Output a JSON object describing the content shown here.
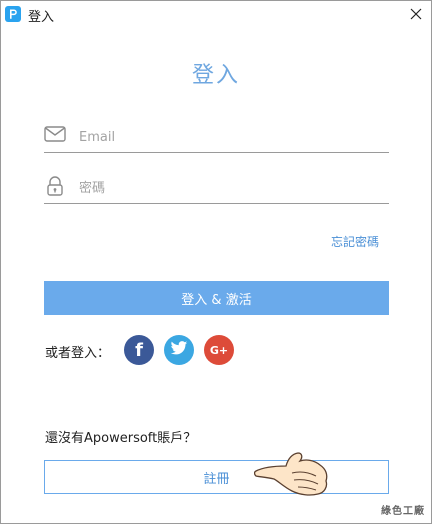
{
  "window": {
    "title": "登入",
    "app_icon": "apowersoft-p-icon",
    "close_icon": "close-icon"
  },
  "heading": "登入",
  "email": {
    "placeholder": "Email",
    "value": "",
    "icon": "envelope-icon"
  },
  "password": {
    "placeholder": "密碼",
    "value": "",
    "icon": "lock-icon"
  },
  "forgot_password": "忘記密碼",
  "login_button": "登入 & 激活",
  "social": {
    "label": "或者登入：",
    "providers": [
      {
        "name": "facebook",
        "glyph": "f",
        "color": "#3b5998"
      },
      {
        "name": "twitter",
        "glyph": "twitter-bird",
        "color": "#3ba7e2"
      },
      {
        "name": "google-plus",
        "glyph": "G+",
        "color": "#dd4b39"
      }
    ]
  },
  "no_account_text": "還沒有Apowersoft賬戶？",
  "register_button": "註冊",
  "watermark": "綠色工廠",
  "colors": {
    "accent": "#6aaaeb",
    "link": "#4a8fd6",
    "heading": "#6fa7e0"
  }
}
